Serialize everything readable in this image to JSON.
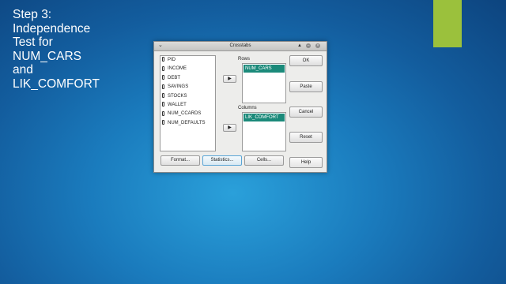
{
  "slide": {
    "title": "Step 3:\nIndependence\nTest for\nNUM_CARS\nand\nLIK_COMFORT"
  },
  "colors": {
    "accent": "#9bc13c",
    "selection": "#1b8a7a"
  },
  "dialog": {
    "title": "Crosstabs",
    "variables": [
      "PID",
      "INCOME",
      "DEBT",
      "SAVINGS",
      "STOCKS",
      "WALLET",
      "NUM_CCARDS",
      "NUM_DEFAULTS"
    ],
    "rows_label": "Rows",
    "rows_value": "NUM_CARS",
    "columns_label": "Columns",
    "columns_value": "LIK_COMFORT",
    "buttons": {
      "ok": "OK",
      "paste": "Paste",
      "cancel": "Cancel",
      "reset": "Reset",
      "help": "Help",
      "format": "Format...",
      "statistics": "Statistics...",
      "cells": "Cells..."
    }
  }
}
